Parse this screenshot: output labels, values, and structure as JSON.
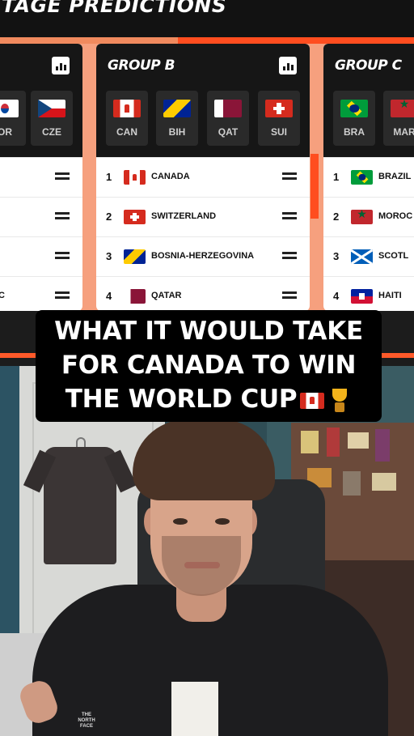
{
  "header": {
    "title": "TAGE PREDICTIONS"
  },
  "groups": [
    {
      "name": "",
      "teams": [
        {
          "code": "OR",
          "flag": "kor-flag"
        },
        {
          "code": "CZE",
          "flag": "cze-flag"
        }
      ],
      "standings": [
        {
          "pos": "",
          "name": ""
        },
        {
          "pos": "",
          "name": ""
        },
        {
          "pos": "",
          "name": ""
        },
        {
          "pos": "",
          "name": "C"
        }
      ]
    },
    {
      "name": "GROUP B",
      "teams": [
        {
          "code": "CAN",
          "flag": "canada-flag"
        },
        {
          "code": "BIH",
          "flag": "bosnia-flag"
        },
        {
          "code": "QAT",
          "flag": "qatar-flag"
        },
        {
          "code": "SUI",
          "flag": "switzerland-flag"
        }
      ],
      "standings": [
        {
          "pos": "1",
          "name": "CANADA"
        },
        {
          "pos": "2",
          "name": "SWITZERLAND"
        },
        {
          "pos": "3",
          "name": "BOSNIA-HERZEGOVINA"
        },
        {
          "pos": "4",
          "name": "QATAR"
        }
      ]
    },
    {
      "name": "GROUP C",
      "teams": [
        {
          "code": "BRA",
          "flag": "brazil-flag"
        },
        {
          "code": "MAR",
          "flag": "morocco-flag"
        }
      ],
      "standings": [
        {
          "pos": "1",
          "name": "BRAZIL"
        },
        {
          "pos": "2",
          "name": "MOROC"
        },
        {
          "pos": "3",
          "name": "SCOTL"
        },
        {
          "pos": "4",
          "name": "HAITI"
        }
      ]
    }
  ],
  "caption": {
    "line1": "WHAT IT WOULD TAKE",
    "line2": "FOR CANADA TO WIN",
    "line3": "THE WORLD CUP",
    "emojis": [
      "canada-flag-emoji",
      "trophy-emoji"
    ]
  },
  "scene": {
    "shirt_logo": "THE NORTH FACE"
  },
  "colors": {
    "accent": "#ff4d1f",
    "peach": "#f6a07e",
    "card_dark": "#161616"
  }
}
